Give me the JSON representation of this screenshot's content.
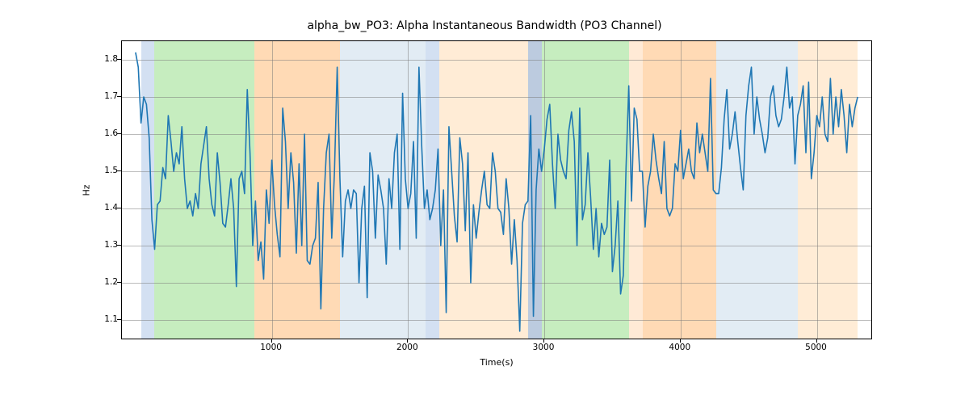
{
  "chart_data": {
    "type": "line",
    "title": "alpha_bw_PO3: Alpha Instantaneous Bandwidth (PO3 Channel)",
    "xlabel": "Time(s)",
    "ylabel": "Hz",
    "xlim": [
      -100,
      5400
    ],
    "ylim": [
      1.05,
      1.85
    ],
    "xticks": [
      1000,
      2000,
      3000,
      4000,
      5000
    ],
    "yticks": [
      1.1,
      1.2,
      1.3,
      1.4,
      1.5,
      1.6,
      1.7,
      1.8
    ],
    "line_color": "#1f77b4",
    "bands": [
      {
        "x0": 40,
        "x1": 140,
        "color": "#aec7e8",
        "alpha": 0.55
      },
      {
        "x0": 140,
        "x1": 870,
        "color": "#98df8a",
        "alpha": 0.55
      },
      {
        "x0": 870,
        "x1": 1000,
        "color": "#ffbb78",
        "alpha": 0.55
      },
      {
        "x0": 1000,
        "x1": 1500,
        "color": "#ffbb78",
        "alpha": 0.55
      },
      {
        "x0": 1500,
        "x1": 2130,
        "color": "#d6e4f0",
        "alpha": 0.7
      },
      {
        "x0": 2130,
        "x1": 2230,
        "color": "#aec7e8",
        "alpha": 0.55
      },
      {
        "x0": 2230,
        "x1": 2880,
        "color": "#ffe7cc",
        "alpha": 0.8
      },
      {
        "x0": 2880,
        "x1": 2980,
        "color": "#8fa9c9",
        "alpha": 0.6
      },
      {
        "x0": 2980,
        "x1": 3620,
        "color": "#98df8a",
        "alpha": 0.55
      },
      {
        "x0": 3620,
        "x1": 3720,
        "color": "#ffbb78",
        "alpha": 0.3
      },
      {
        "x0": 3720,
        "x1": 4260,
        "color": "#ffbb78",
        "alpha": 0.55
      },
      {
        "x0": 4260,
        "x1": 4860,
        "color": "#d6e4f0",
        "alpha": 0.7
      },
      {
        "x0": 4860,
        "x1": 5300,
        "color": "#ffe7cc",
        "alpha": 0.8
      }
    ],
    "series": [
      {
        "name": "alpha_bw_PO3",
        "x": [
          0,
          20,
          40,
          60,
          80,
          100,
          120,
          140,
          160,
          180,
          200,
          220,
          240,
          260,
          280,
          300,
          320,
          340,
          360,
          380,
          400,
          420,
          440,
          460,
          480,
          500,
          520,
          540,
          560,
          580,
          600,
          620,
          640,
          660,
          680,
          700,
          720,
          740,
          760,
          780,
          800,
          820,
          840,
          860,
          880,
          900,
          920,
          940,
          960,
          980,
          1000,
          1020,
          1040,
          1060,
          1080,
          1100,
          1120,
          1140,
          1160,
          1180,
          1200,
          1220,
          1240,
          1260,
          1280,
          1300,
          1320,
          1340,
          1360,
          1380,
          1400,
          1420,
          1440,
          1460,
          1480,
          1500,
          1520,
          1540,
          1560,
          1580,
          1600,
          1620,
          1640,
          1660,
          1680,
          1700,
          1720,
          1740,
          1760,
          1780,
          1800,
          1820,
          1840,
          1860,
          1880,
          1900,
          1920,
          1940,
          1960,
          1980,
          2000,
          2020,
          2040,
          2060,
          2080,
          2100,
          2120,
          2140,
          2160,
          2180,
          2200,
          2220,
          2240,
          2260,
          2280,
          2300,
          2320,
          2340,
          2360,
          2380,
          2400,
          2420,
          2440,
          2460,
          2480,
          2500,
          2520,
          2540,
          2560,
          2580,
          2600,
          2620,
          2640,
          2660,
          2680,
          2700,
          2720,
          2740,
          2760,
          2780,
          2800,
          2820,
          2840,
          2860,
          2880,
          2900,
          2920,
          2940,
          2960,
          2980,
          3000,
          3020,
          3040,
          3060,
          3080,
          3100,
          3120,
          3140,
          3160,
          3180,
          3200,
          3220,
          3240,
          3260,
          3280,
          3300,
          3320,
          3340,
          3360,
          3380,
          3400,
          3420,
          3440,
          3460,
          3480,
          3500,
          3520,
          3540,
          3560,
          3580,
          3600,
          3620,
          3640,
          3660,
          3680,
          3700,
          3720,
          3740,
          3760,
          3780,
          3800,
          3820,
          3840,
          3860,
          3880,
          3900,
          3920,
          3940,
          3960,
          3980,
          4000,
          4020,
          4040,
          4060,
          4080,
          4100,
          4120,
          4140,
          4160,
          4180,
          4200,
          4220,
          4240,
          4260,
          4280,
          4300,
          4320,
          4340,
          4360,
          4380,
          4400,
          4420,
          4440,
          4460,
          4480,
          4500,
          4520,
          4540,
          4560,
          4580,
          4600,
          4620,
          4640,
          4660,
          4680,
          4700,
          4720,
          4740,
          4760,
          4780,
          4800,
          4820,
          4840,
          4860,
          4880,
          4900,
          4920,
          4940,
          4960,
          4980,
          5000,
          5020,
          5040,
          5060,
          5080,
          5100,
          5120,
          5140,
          5160,
          5180,
          5200,
          5220,
          5240,
          5260,
          5280,
          5300
        ],
        "y": [
          1.82,
          1.78,
          1.63,
          1.7,
          1.68,
          1.59,
          1.37,
          1.29,
          1.41,
          1.42,
          1.51,
          1.48,
          1.65,
          1.58,
          1.5,
          1.55,
          1.52,
          1.62,
          1.48,
          1.4,
          1.42,
          1.38,
          1.44,
          1.4,
          1.52,
          1.57,
          1.62,
          1.48,
          1.41,
          1.38,
          1.55,
          1.47,
          1.36,
          1.35,
          1.41,
          1.48,
          1.4,
          1.19,
          1.48,
          1.5,
          1.44,
          1.72,
          1.55,
          1.3,
          1.42,
          1.26,
          1.31,
          1.21,
          1.45,
          1.36,
          1.53,
          1.41,
          1.33,
          1.27,
          1.67,
          1.58,
          1.4,
          1.55,
          1.47,
          1.28,
          1.52,
          1.3,
          1.6,
          1.26,
          1.25,
          1.3,
          1.32,
          1.47,
          1.13,
          1.4,
          1.55,
          1.6,
          1.32,
          1.5,
          1.78,
          1.48,
          1.27,
          1.42,
          1.45,
          1.4,
          1.45,
          1.44,
          1.2,
          1.4,
          1.46,
          1.16,
          1.55,
          1.5,
          1.32,
          1.49,
          1.45,
          1.4,
          1.25,
          1.48,
          1.4,
          1.55,
          1.6,
          1.29,
          1.71,
          1.48,
          1.4,
          1.44,
          1.58,
          1.32,
          1.78,
          1.57,
          1.4,
          1.45,
          1.37,
          1.4,
          1.45,
          1.56,
          1.3,
          1.45,
          1.12,
          1.62,
          1.5,
          1.38,
          1.31,
          1.59,
          1.52,
          1.34,
          1.55,
          1.2,
          1.41,
          1.32,
          1.39,
          1.45,
          1.5,
          1.41,
          1.4,
          1.55,
          1.5,
          1.4,
          1.39,
          1.33,
          1.48,
          1.4,
          1.25,
          1.37,
          1.26,
          1.07,
          1.36,
          1.41,
          1.42,
          1.65,
          1.11,
          1.45,
          1.56,
          1.5,
          1.56,
          1.64,
          1.68,
          1.52,
          1.4,
          1.6,
          1.53,
          1.5,
          1.48,
          1.61,
          1.66,
          1.58,
          1.3,
          1.67,
          1.37,
          1.41,
          1.55,
          1.43,
          1.29,
          1.4,
          1.27,
          1.36,
          1.33,
          1.35,
          1.53,
          1.23,
          1.3,
          1.42,
          1.17,
          1.22,
          1.51,
          1.73,
          1.42,
          1.67,
          1.64,
          1.5,
          1.5,
          1.35,
          1.46,
          1.5,
          1.6,
          1.53,
          1.48,
          1.44,
          1.58,
          1.4,
          1.38,
          1.4,
          1.52,
          1.5,
          1.61,
          1.48,
          1.52,
          1.56,
          1.5,
          1.48,
          1.63,
          1.55,
          1.6,
          1.55,
          1.5,
          1.75,
          1.45,
          1.44,
          1.44,
          1.51,
          1.64,
          1.72,
          1.56,
          1.6,
          1.66,
          1.58,
          1.51,
          1.45,
          1.65,
          1.73,
          1.78,
          1.6,
          1.7,
          1.64,
          1.6,
          1.55,
          1.59,
          1.7,
          1.73,
          1.65,
          1.62,
          1.64,
          1.7,
          1.78,
          1.67,
          1.7,
          1.52,
          1.65,
          1.68,
          1.73,
          1.55,
          1.74,
          1.48,
          1.55,
          1.65,
          1.62,
          1.7,
          1.6,
          1.58,
          1.75,
          1.6,
          1.7,
          1.62,
          1.72,
          1.65,
          1.55,
          1.68,
          1.62,
          1.67,
          1.7
        ]
      }
    ]
  }
}
